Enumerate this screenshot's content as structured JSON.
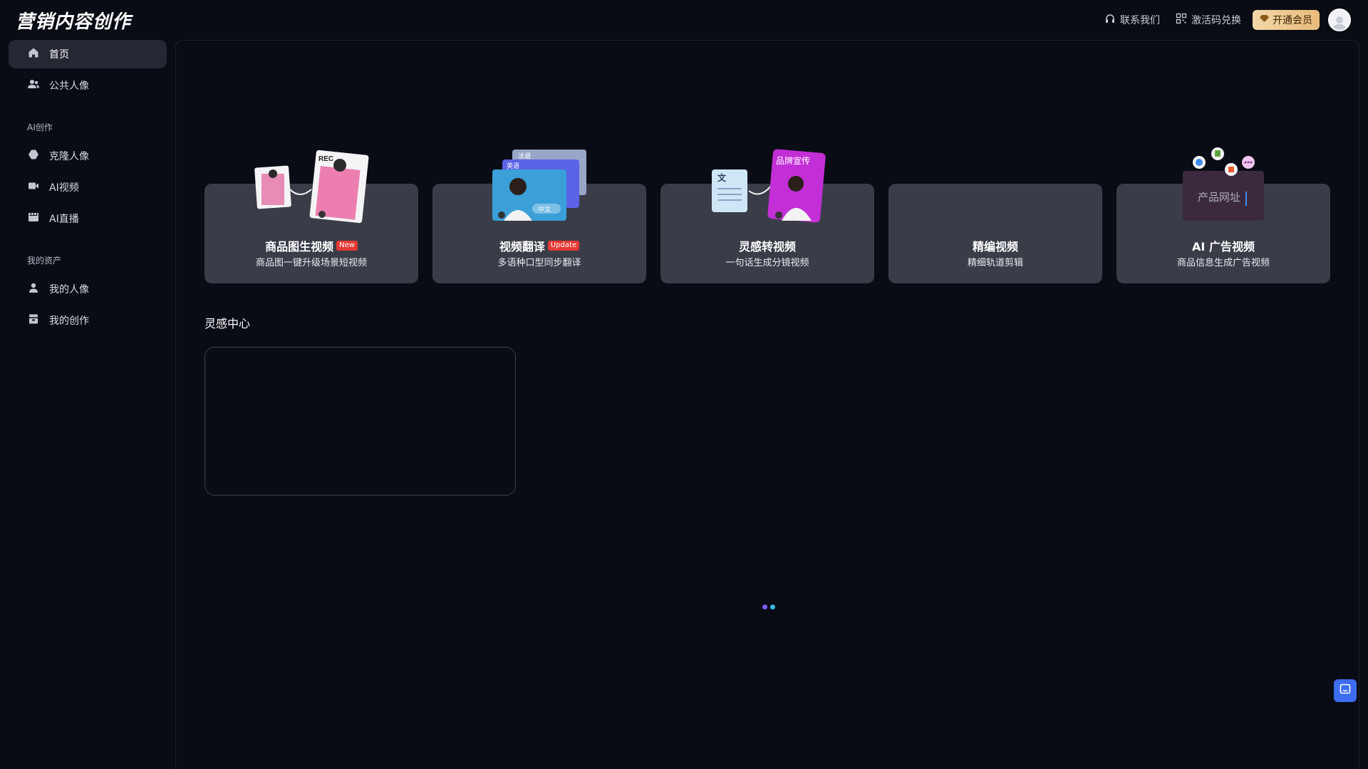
{
  "header": {
    "logo": "营销内容创作",
    "contact_label": "联系我们",
    "redeem_label": "激活码兑换",
    "vip_label": "开通会员"
  },
  "sidebar": {
    "items": [
      {
        "label": "首页",
        "icon": "home-icon",
        "active": true
      },
      {
        "label": "公共人像",
        "icon": "users-icon"
      }
    ],
    "sections": [
      {
        "title": "AI创作",
        "items": [
          {
            "label": "克隆人像",
            "icon": "clone-icon"
          },
          {
            "label": "AI视频",
            "icon": "video-icon"
          },
          {
            "label": "AI直播",
            "icon": "live-icon"
          }
        ]
      },
      {
        "title": "我的资产",
        "items": [
          {
            "label": "我的人像",
            "icon": "user-icon"
          },
          {
            "label": "我的创作",
            "icon": "archive-icon"
          }
        ]
      }
    ]
  },
  "cards": [
    {
      "title": "商品图生视频",
      "tag": "New",
      "subtitle": "商品图一键升级场景短视频",
      "art": {
        "rec_label": "REC"
      }
    },
    {
      "title": "视频翻译",
      "tag": "Update",
      "subtitle": "多语种口型同步翻译",
      "art": {
        "lang_back": "法语",
        "lang_mid": "英语",
        "lang_front": "中文"
      }
    },
    {
      "title": "灵感转视频",
      "tag": "",
      "subtitle": "一句话生成分镜视频",
      "art": {
        "doc_label": "文",
        "brand_label": "品牌宣传"
      }
    },
    {
      "title": "精编视频",
      "tag": "",
      "subtitle": "精细轨道剪辑"
    },
    {
      "title": "AI 广告视频",
      "tag": "",
      "subtitle": "商品信息生成广告视频",
      "art": {
        "input_label": "产品网址"
      }
    }
  ],
  "inspiration": {
    "title": "灵感中心"
  },
  "colors": {
    "background": "#0a0c15",
    "card": "#3a3d48",
    "accent_blue": "#3c6cf0",
    "vip_gold": "#e8bb7a",
    "loader_dot_1": "#7b5cf0",
    "loader_dot_2": "#35b7e8"
  }
}
